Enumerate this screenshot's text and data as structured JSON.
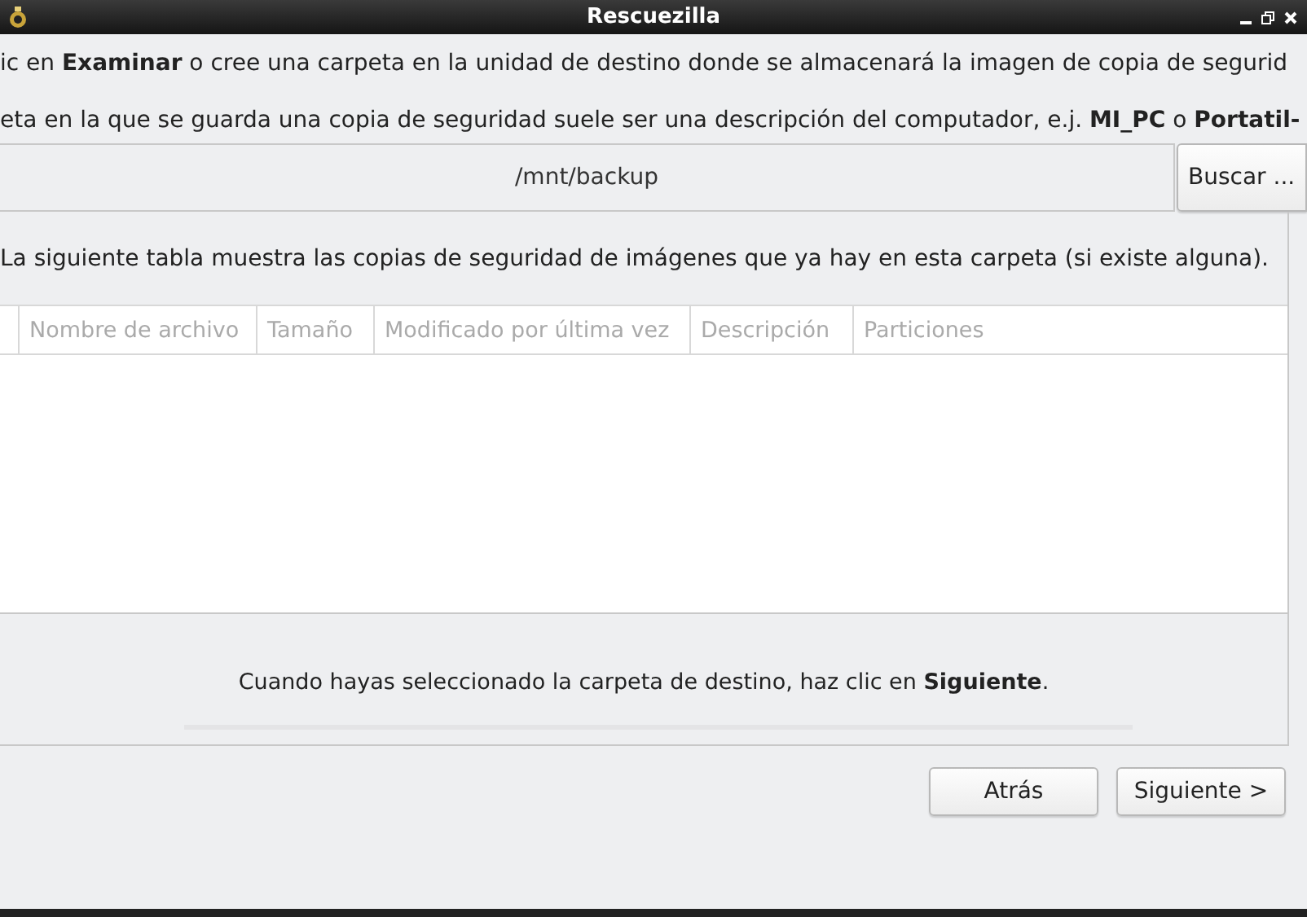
{
  "window": {
    "title": "Rescuezilla"
  },
  "instructions": [
    "ic en **Examinar** o cree una carpeta en la unidad de destino donde se almacenará la imagen de copia de segurid",
    "eta en la que se guarda una copia de seguridad suele ser una descripción del computador, e.j. **MI_PC** o **Portatil-**"
  ],
  "path_field": {
    "value": "/mnt/backup"
  },
  "browse_button": "Buscar ...",
  "table_caption": "La siguiente tabla muestra las copias de seguridad de imágenes que ya hay en esta carpeta (si existe alguna).",
  "table": {
    "columns": [
      "Nombre de archivo",
      "Tamaño",
      "Modificado por última vez",
      "Descripción",
      "Particiones"
    ]
  },
  "footer_hint": "Cuando hayas seleccionado la carpeta de destino, haz clic en **Siguiente**.",
  "buttons": [
    "Atrás",
    "Siguiente >"
  ]
}
